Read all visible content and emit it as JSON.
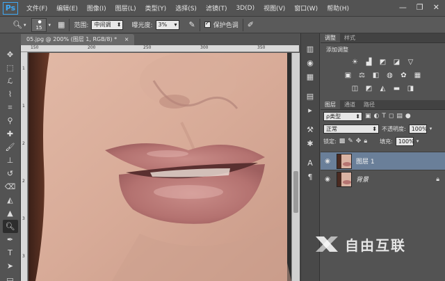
{
  "app": {
    "logo": "Ps"
  },
  "menu": [
    "文件(F)",
    "编辑(E)",
    "图像(I)",
    "图层(L)",
    "类型(Y)",
    "选择(S)",
    "滤镜(T)",
    "3D(D)",
    "视图(V)",
    "窗口(W)",
    "帮助(H)"
  ],
  "window_controls": {
    "minimize": "—",
    "restore": "❐",
    "close": "✕"
  },
  "options": {
    "brush_size": "15",
    "range_label": "范围:",
    "range_value": "中间调",
    "exposure_label": "曝光度:",
    "exposure_value": "3%",
    "protect_label": "保护色调"
  },
  "document": {
    "tab_title": "05.jpg @ 200% (图层 1, RGB/8) *",
    "close": "×"
  },
  "ruler_top": [
    "150",
    "200",
    "250",
    "300",
    "350"
  ],
  "ruler_left": [
    "1",
    "1",
    "2",
    "2",
    "3",
    "3"
  ],
  "adjustments": {
    "tabs": [
      "调整",
      "样式"
    ],
    "title": "添加调整"
  },
  "layers": {
    "tabs": [
      "图层",
      "通道",
      "路径"
    ],
    "filter_label": "ρ类型",
    "blend_mode": "正常",
    "opacity_label": "不透明度:",
    "opacity_value": "100%",
    "lock_label": "锁定:",
    "fill_label": "填充:",
    "fill_value": "100%",
    "items": [
      {
        "name": "图层 1",
        "selected": true
      },
      {
        "name": "背景",
        "locked": true
      }
    ]
  },
  "watermark": {
    "text": "自由互联"
  },
  "colors": {
    "accent": "#3fa9f5",
    "selected_layer": "#6a7f99"
  }
}
